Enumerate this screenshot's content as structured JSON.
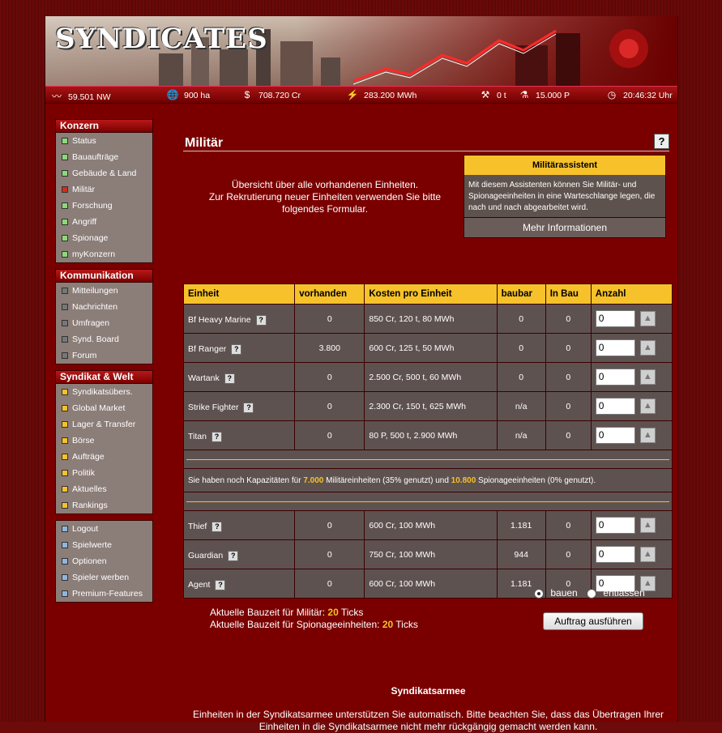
{
  "header": {
    "logo": "SYNDICATES",
    "stats": [
      {
        "icon": "networth-icon",
        "glyph": "〰",
        "value": "59.501 NW"
      },
      {
        "icon": "globe-icon",
        "glyph": "🌐",
        "value": "900 ha"
      },
      {
        "icon": "dollar-icon",
        "glyph": "$",
        "value": "708.720 Cr"
      },
      {
        "icon": "energy-icon",
        "glyph": "⚡",
        "value": "283.200 MWh"
      },
      {
        "icon": "tools-icon",
        "glyph": "⚒",
        "value": "0 t"
      },
      {
        "icon": "research-icon",
        "glyph": "⚗",
        "value": "15.000 P"
      },
      {
        "icon": "clock-icon",
        "glyph": "◷",
        "value": "20:46:32 Uhr"
      }
    ]
  },
  "sidebar": {
    "konzern": {
      "title": "Konzern",
      "items": [
        "Status",
        "Bauaufträge",
        "Gebäude & Land",
        "Militär",
        "Forschung",
        "Angriff",
        "Spionage",
        "myKonzern"
      ]
    },
    "kommunikation": {
      "title": "Kommunikation",
      "items": [
        "Mitteilungen",
        "Nachrichten",
        "Umfragen",
        "Synd. Board",
        "Forum"
      ]
    },
    "syndikat": {
      "title": "Syndikat & Welt",
      "items": [
        "Syndikatsübers.",
        "Global Market",
        "Lager & Transfer",
        "Börse",
        "Aufträge",
        "Politik",
        "Aktuelles",
        "Rankings"
      ]
    },
    "account": {
      "items": [
        "Logout",
        "Spielwerte",
        "Optionen",
        "Spieler werben",
        "Premium-Features"
      ]
    }
  },
  "colors": {
    "green": "#8cd97a",
    "red": "#d62c1a",
    "gray": "#777777",
    "yellow": "#f6c12a",
    "blue": "#8fb6e0"
  },
  "main": {
    "title": "Militär",
    "help": "?",
    "intro_line1": "Übersicht über alle vorhandenen Einheiten.",
    "intro_line2": "Zur Rekrutierung neuer Einheiten verwenden Sie bitte folgendes Formular.",
    "assistant": {
      "title": "Militärassistent",
      "text": "Mit diesem Assistenten können Sie Militär- und Spionageeinheiten in eine Warteschlange legen, die nach und nach abgearbeitet wird.",
      "more": "Mehr Informationen"
    },
    "table": {
      "headers": [
        "Einheit",
        "vorhanden",
        "Kosten pro Einheit",
        "baubar",
        "In Bau",
        "Anzahl"
      ],
      "military": [
        {
          "name": "Bf Heavy Marine",
          "have": "0",
          "cost": "850 Cr, 120 t, 80 MWh",
          "buildable": "0",
          "inbuild": "0",
          "qty": "0"
        },
        {
          "name": "Bf Ranger",
          "have": "3.800",
          "cost": "600 Cr, 125 t, 50 MWh",
          "buildable": "0",
          "inbuild": "0",
          "qty": "0"
        },
        {
          "name": "Wartank",
          "have": "0",
          "cost": "2.500 Cr, 500 t, 60 MWh",
          "buildable": "0",
          "inbuild": "0",
          "qty": "0"
        },
        {
          "name": "Strike Fighter",
          "have": "0",
          "cost": "2.300 Cr, 150 t, 625 MWh",
          "buildable": "n/a",
          "inbuild": "0",
          "qty": "0"
        },
        {
          "name": "Titan",
          "have": "0",
          "cost": "80 P, 500 t, 2.900 MWh",
          "buildable": "n/a",
          "inbuild": "0",
          "qty": "0"
        }
      ],
      "capacity": {
        "pre": "Sie haben noch Kapazitäten für ",
        "mil": "7.000",
        "mid": " Militäreinheiten (35% genutzt) und ",
        "spy": "10.800",
        "post": " Spionageeinheiten (0% genutzt)."
      },
      "spies": [
        {
          "name": "Thief",
          "have": "0",
          "cost": "600 Cr, 100 MWh",
          "buildable": "1.181",
          "inbuild": "0",
          "qty": "0"
        },
        {
          "name": "Guardian",
          "have": "0",
          "cost": "750 Cr, 100 MWh",
          "buildable": "944",
          "inbuild": "0",
          "qty": "0"
        },
        {
          "name": "Agent",
          "have": "0",
          "cost": "600 Cr, 100 MWh",
          "buildable": "1.181",
          "inbuild": "0",
          "qty": "0"
        }
      ]
    },
    "mode": {
      "build": "bauen",
      "dismiss": "entlassen"
    },
    "ticks": {
      "mil_label": "Aktuelle Bauzeit für Militär: ",
      "mil_value": "20",
      "spy_label": "Aktuelle Bauzeit für Spionageeinheiten: ",
      "spy_value": "20",
      "unit": " Ticks"
    },
    "submit": "Auftrag ausführen",
    "army_title": "Syndikatsarmee",
    "army_text": "Einheiten in der Syndikatsarmee unterstützen Sie automatisch. Bitte beachten Sie, dass das Übertragen Ihrer Einheiten in die Syndikatsarmee nicht mehr rückgängig gemacht werden kann."
  }
}
